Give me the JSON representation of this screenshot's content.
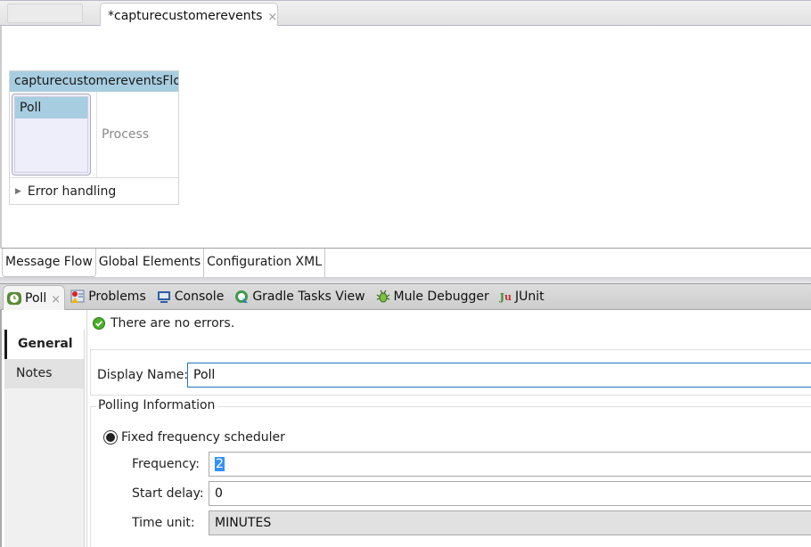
{
  "editor": {
    "tab_title": "*capturecustomerevents",
    "tab_icon": "mule-icon",
    "close_glyph": "×"
  },
  "canvas": {
    "flow_name": "capturecustomereventsFlow",
    "source_element": "Poll",
    "process_placeholder": "Process",
    "error_handling_label": "Error handling",
    "expand_glyph": "▶"
  },
  "editor_pages": [
    {
      "label": "Message Flow",
      "active": true
    },
    {
      "label": "Global Elements",
      "active": false
    },
    {
      "label": "Configuration XML",
      "active": false
    }
  ],
  "views": [
    {
      "label": "Poll",
      "icon": "clock-icon",
      "active": true,
      "closable": true
    },
    {
      "label": "Problems",
      "icon": "problems-icon",
      "active": false
    },
    {
      "label": "Console",
      "icon": "console-icon",
      "active": false
    },
    {
      "label": "Gradle Tasks View",
      "icon": "gradle-icon",
      "active": false
    },
    {
      "label": "Mule Debugger",
      "icon": "bug-icon",
      "active": false
    },
    {
      "label": "JUnit",
      "icon": "junit-icon",
      "active": false
    }
  ],
  "properties": {
    "sidebar": [
      {
        "label": "General",
        "active": true
      },
      {
        "label": "Notes",
        "active": false
      }
    ],
    "status": "There are no errors.",
    "display_name_label": "Display Name:",
    "display_name_value": "Poll",
    "polling_group_title": "Polling Information",
    "scheduler_option": "Fixed frequency scheduler",
    "scheduler_selected": true,
    "fields": {
      "frequency_label": "Frequency:",
      "frequency_value": "2",
      "start_delay_label": "Start delay:",
      "start_delay_value": "0",
      "time_unit_label": "Time unit:",
      "time_unit_value": "MINUTES"
    }
  },
  "colors": {
    "flow_header": "#a7cde0",
    "focus_border": "#1f74c0",
    "selection": "#3391ff",
    "ok_green": "#4caf2a"
  }
}
